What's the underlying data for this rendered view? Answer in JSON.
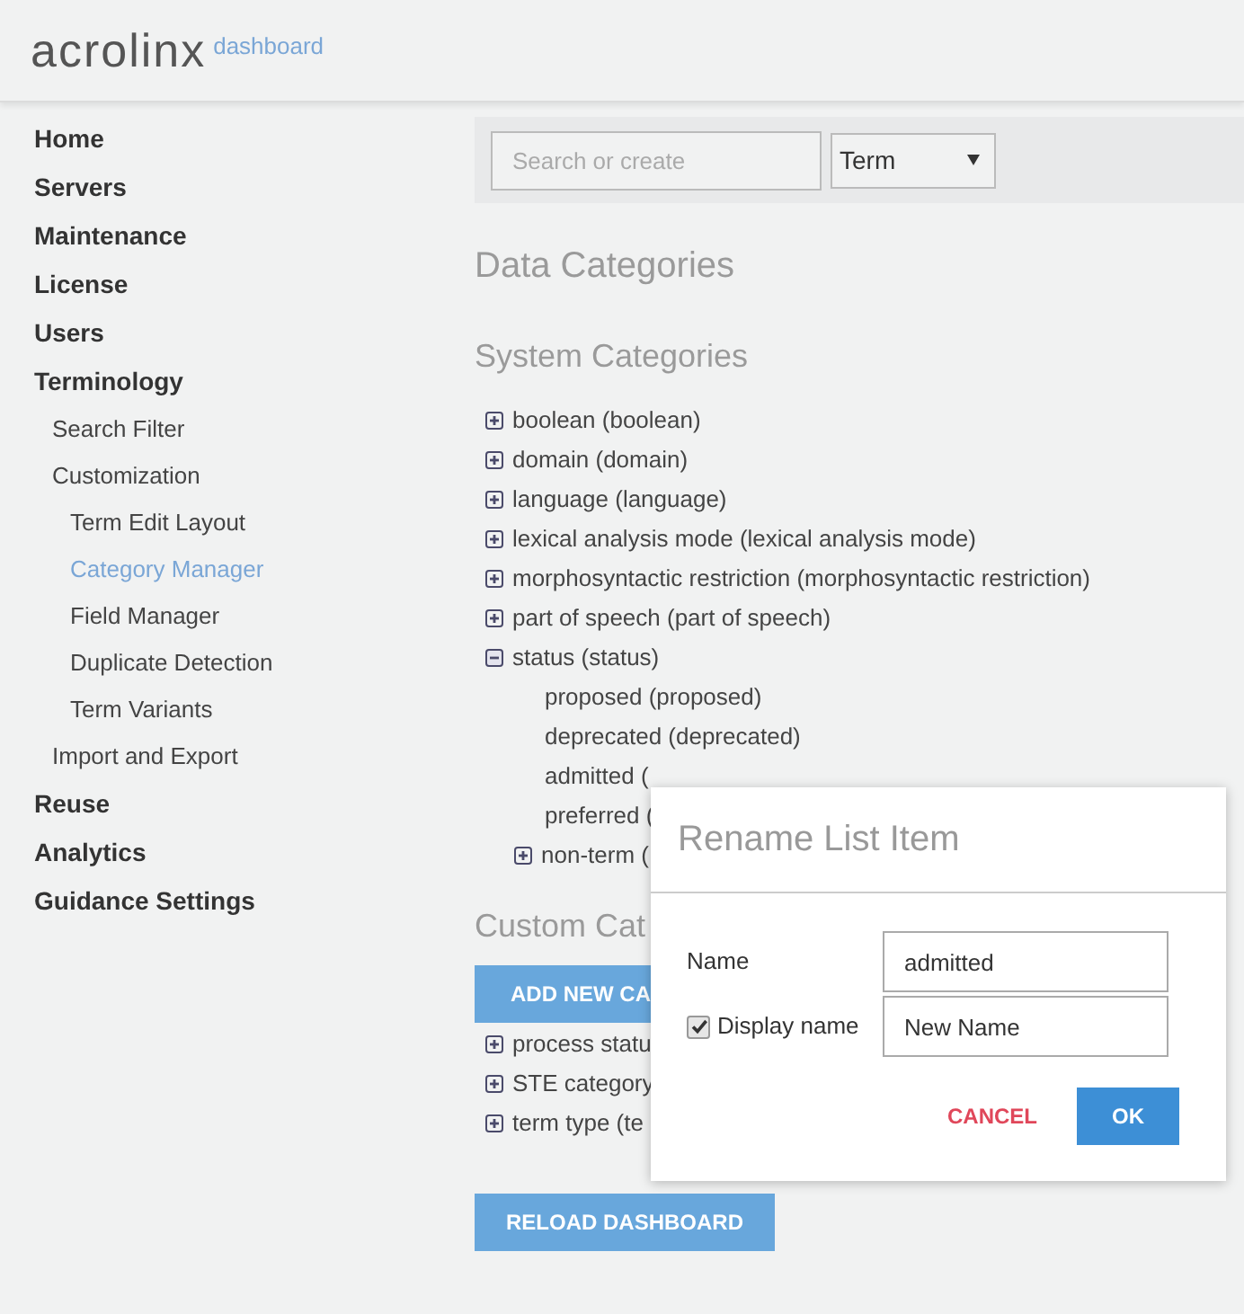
{
  "header": {
    "logo": "acrolinx",
    "subtitle": "dashboard"
  },
  "sidebar": {
    "items": [
      {
        "label": "Home",
        "selected": false
      },
      {
        "label": "Servers",
        "selected": false
      },
      {
        "label": "Maintenance",
        "selected": false
      },
      {
        "label": "License",
        "selected": false
      },
      {
        "label": "Users",
        "selected": false
      },
      {
        "label": "Terminology",
        "selected": false,
        "children": [
          {
            "label": "Search Filter",
            "selected": false
          },
          {
            "label": "Customization",
            "selected": false,
            "children": [
              {
                "label": "Term Edit Layout",
                "selected": false
              },
              {
                "label": "Category Manager",
                "selected": true
              },
              {
                "label": "Field Manager",
                "selected": false
              },
              {
                "label": "Duplicate Detection",
                "selected": false
              },
              {
                "label": "Term Variants",
                "selected": false
              }
            ]
          },
          {
            "label": "Import and Export",
            "selected": false
          }
        ]
      },
      {
        "label": "Reuse",
        "selected": false
      },
      {
        "label": "Analytics",
        "selected": false
      },
      {
        "label": "Guidance Settings",
        "selected": false
      }
    ]
  },
  "search": {
    "placeholder": "Search or create",
    "type_select": "Term"
  },
  "title": "Data Categories",
  "system_categories": {
    "heading": "System Categories",
    "items": [
      {
        "label": "boolean (boolean)",
        "kind": "category",
        "expanded": false
      },
      {
        "label": "domain (domain)",
        "kind": "category",
        "expanded": false
      },
      {
        "label": "language (language)",
        "kind": "category",
        "expanded": false
      },
      {
        "label": "lexical analysis mode (lexical analysis mode)",
        "kind": "category",
        "expanded": false
      },
      {
        "label": "morphosyntactic restriction (morphosyntactic restriction)",
        "kind": "category",
        "expanded": false
      },
      {
        "label": "part of speech (part of speech)",
        "kind": "category",
        "expanded": false
      },
      {
        "label": "status (status)",
        "kind": "category",
        "expanded": true,
        "children": [
          {
            "label": "proposed (proposed)",
            "kind": "value"
          },
          {
            "label": "deprecated (deprecated)",
            "kind": "value"
          },
          {
            "label": "admitted (",
            "kind": "value"
          },
          {
            "label": "preferred (",
            "kind": "value"
          },
          {
            "label": "non-term (",
            "kind": "category",
            "expanded": false
          }
        ]
      }
    ]
  },
  "custom_categories": {
    "heading": "Custom Cat",
    "add_button": "ADD NEW CA",
    "items": [
      {
        "label": "process statu",
        "kind": "category",
        "expanded": false
      },
      {
        "label": "STE category",
        "kind": "category",
        "expanded": false
      },
      {
        "label": "term type (te",
        "kind": "category",
        "expanded": false
      }
    ]
  },
  "reload_button": "RELOAD DASHBOARD",
  "dialog": {
    "title": "Rename List Item",
    "fields": [
      {
        "label": "Name",
        "value": "admitted",
        "kind": "text"
      },
      {
        "label": "Display name",
        "value": "New Name",
        "kind": "checkbox",
        "checked": true
      }
    ],
    "cancel": "CANCEL",
    "ok": "OK"
  }
}
